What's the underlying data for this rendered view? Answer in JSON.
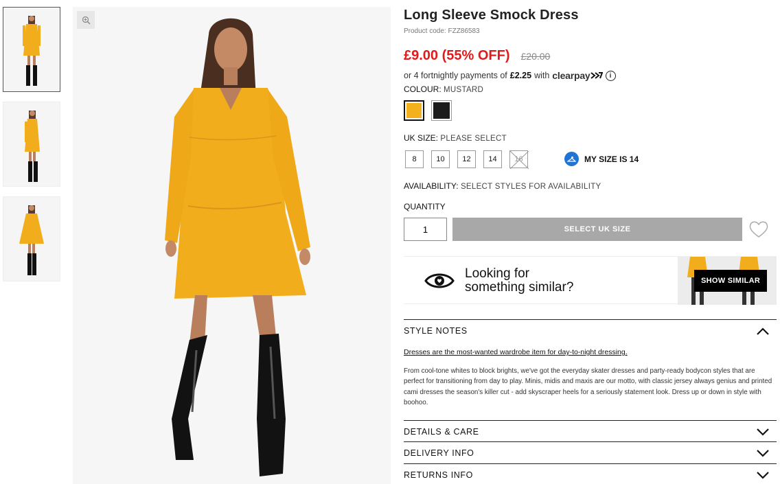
{
  "product": {
    "title": "Long Sleeve Smock Dress",
    "code": "Product code: FZZ86583",
    "price": "£9.00 (55% OFF)",
    "was_price": "£20.00",
    "clearpay_text": "or 4 fortnightly payments of",
    "clearpay_amount": "£2.25",
    "clearpay_with": "with",
    "clearpay_brand": "clearpay",
    "info_glyph": "i"
  },
  "colour": {
    "label": "COLOUR:",
    "selected": "MUSTARD",
    "swatches": [
      {
        "name": "mustard",
        "color": "#f4b11e"
      },
      {
        "name": "black",
        "color": "#1b1b1b"
      }
    ]
  },
  "size": {
    "label": "UK SIZE:",
    "prompt": "PLEASE SELECT",
    "options": [
      "8",
      "10",
      "12",
      "14",
      "16"
    ],
    "my_size": "MY SIZE IS 14"
  },
  "availability": {
    "label": "AVAILABILITY:",
    "value": "SELECT STYLES FOR AVAILABILITY"
  },
  "quantity": {
    "label": "QUANTITY",
    "value": "1",
    "button": "SELECT UK SIZE"
  },
  "similar": {
    "line1": "Looking for",
    "line2": "something similar?",
    "button": "SHOW SIMILAR"
  },
  "style_notes": {
    "heading": "STYLE NOTES",
    "link": "Dresses are the most-wanted wardrobe item for day-to-night dressing.",
    "body": "From cool-tone whites to block brights, we've got the everyday skater dresses and party-ready bodycon styles that are perfect for transitioning from day to play. Minis, midis and maxis are our motto, with classic jersey always genius and printed cami dresses the season's killer cut - add skyscraper heels for a seriously statement look. Dress up or down in style with boohoo."
  },
  "accordions": {
    "details": "DETAILS & CARE",
    "delivery": "DELIVERY INFO",
    "returns": "RETURNS INFO"
  },
  "theme": {
    "sale_red": "#e21a1a",
    "dress_yellow": "#f4b11e",
    "button_grey": "#a8a8a8"
  }
}
